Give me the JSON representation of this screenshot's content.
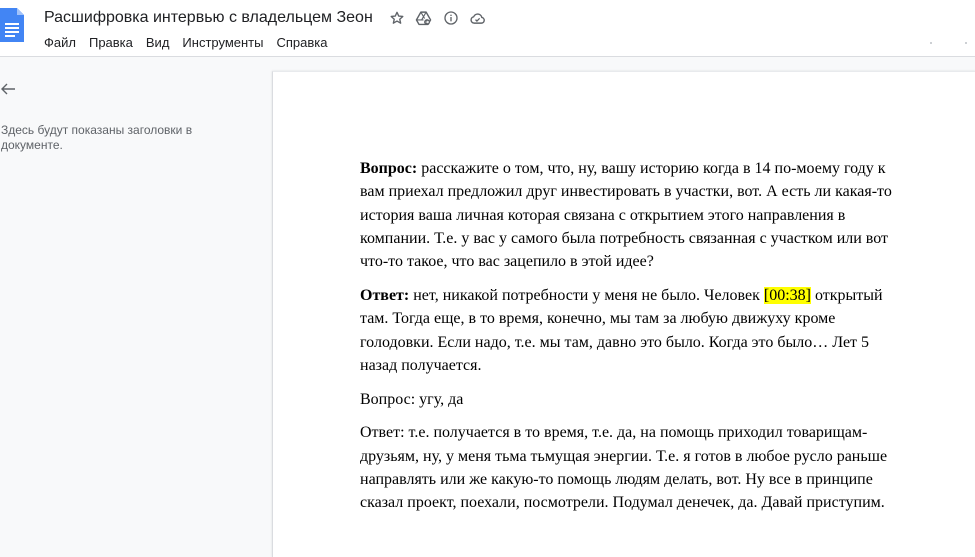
{
  "header": {
    "title": "Расшифровка интервью с владельцем Зеон",
    "icons": [
      "star-icon",
      "move-to-drive-icon",
      "info-icon",
      "cloud-saved-icon"
    ],
    "menu": [
      "Файл",
      "Правка",
      "Вид",
      "Инструменты",
      "Справка"
    ]
  },
  "outline": {
    "back_icon": "arrow-left-icon",
    "hint": "Здесь будут показаны заголовки в документе."
  },
  "document": {
    "p1": {
      "label": "Вопрос:",
      "text": " расскажите о том, что, ну, вашу историю когда в 14 по-моему году к вам приехал предложил друг инвестировать в участки, вот. А есть ли какая-то история ваша личная которая связана с открытием этого направления в компании. Т.е. у вас у самого была потребность связанная с участком или вот что-то такое, что вас зацепило в этой идее?"
    },
    "p2": {
      "label": "Ответ:",
      "text_before": " нет, никакой потребности у меня не было. Человек ",
      "timestamp": "[00:38]",
      "text_after": " открытый там. Тогда еще, в то время, конечно, мы там за любую движуху кроме голодовки. Если надо, т.е. мы там, давно это было. Когда это было… Лет 5 назад получается."
    },
    "p3": "Вопрос: угу, да",
    "p4": "Ответ: т.е. получается в то время, т.е. да, на помощь приходил товарищам-друзьям, ну, у меня тьма тьмущая энергии. Т.е. я готов в любое русло раньше направлять или же какую-то помощь людям делать, вот. Ну все в принципе сказал проект, поехали, посмотрели. Подумал денечек, да. Давай приступим."
  },
  "colors": {
    "docs_blue": "#4285f4",
    "highlight": "#ffff00",
    "icon_gray": "#5f6368"
  }
}
